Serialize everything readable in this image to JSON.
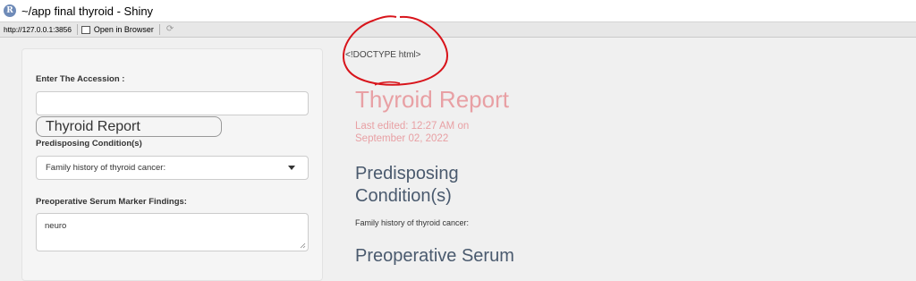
{
  "window": {
    "title": "~/app final thyroid - Shiny",
    "icon_letter": "R"
  },
  "toolbar": {
    "url": "http://127.0.0.1:3856",
    "open_in_browser_label": "Open in Browser"
  },
  "sidebar": {
    "accession_label": "Enter The Accession :",
    "accession_value": "",
    "report_button_label": "Thyroid Report",
    "predisposing_label": "Predisposing Condition(s)",
    "predisposing_selected": "Family history of thyroid cancer:",
    "serum_label": "Preoperative Serum Marker Findings:",
    "serum_value": "neuro"
  },
  "main": {
    "doctype_text": "<!DOCTYPE html>",
    "report_title": "Thyroid Report",
    "last_edited": "Last edited: 12:27 AM on September 02, 2022",
    "predisposing_heading": "Predisposing Condition(s)",
    "predisposing_value": "Family history of thyroid cancer:",
    "preop_heading": "Preoperative Serum"
  },
  "colors": {
    "report_title": "#e8a0a4",
    "heading": "#4a5a6e",
    "annotation_circle": "#d8141b"
  }
}
